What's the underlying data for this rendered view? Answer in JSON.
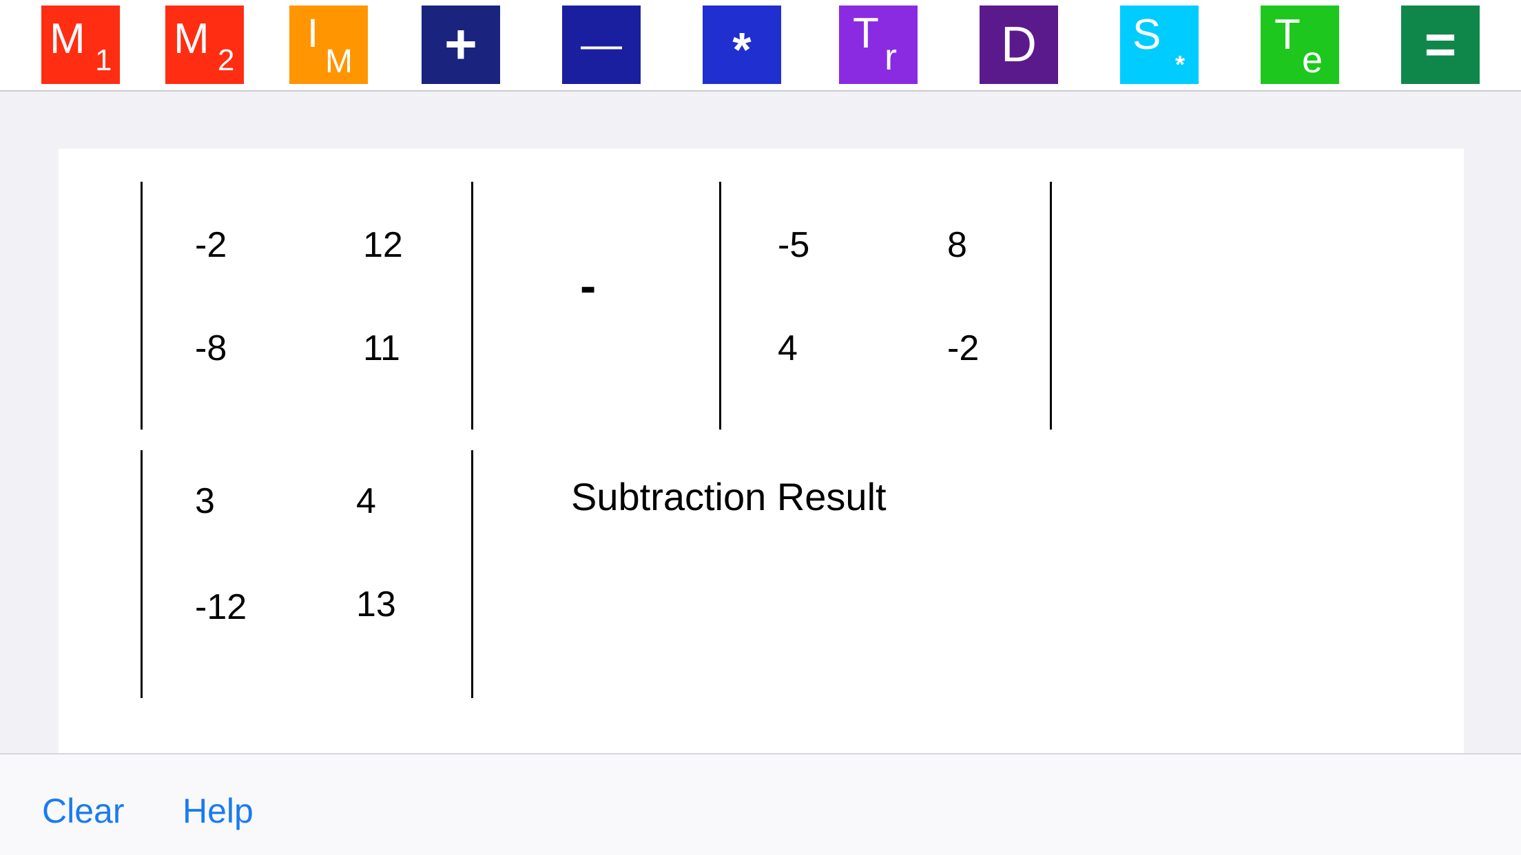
{
  "toolbar": {
    "m1": {
      "main": "M",
      "sub": "1",
      "color": "#ff2d12"
    },
    "m2": {
      "main": "M",
      "sub": "2",
      "color": "#ff2d12"
    },
    "identity": {
      "main": "I",
      "sub": "M",
      "color": "#ff9500"
    },
    "add": {
      "symbol": "+",
      "color": "#1a237e"
    },
    "subtract": {
      "symbol": "—",
      "color": "#1a1fa0"
    },
    "multiply": {
      "symbol": "*",
      "color": "#1f2fd0"
    },
    "transpose": {
      "main": "T",
      "sub": "r",
      "color": "#8a2be2"
    },
    "determinant": {
      "symbol": "D",
      "color": "#5a1a8c"
    },
    "scalar": {
      "main": "S",
      "sub": "*",
      "color": "#00ccff"
    },
    "test": {
      "main": "T",
      "sub": "e",
      "color": "#1ec71e"
    },
    "equals": {
      "symbol": "=",
      "color": "#10874a"
    }
  },
  "matrix1": [
    [
      "-2",
      "12"
    ],
    [
      "-8",
      "11"
    ]
  ],
  "operator": "-",
  "matrix2": [
    [
      "-5",
      "8"
    ],
    [
      "4",
      "-2"
    ]
  ],
  "result": [
    [
      "3",
      "4"
    ],
    [
      "-12",
      "13"
    ]
  ],
  "result_label": "Subtraction Result",
  "footer": {
    "clear": "Clear",
    "help": "Help",
    "link_color": "#1a7bf0"
  }
}
